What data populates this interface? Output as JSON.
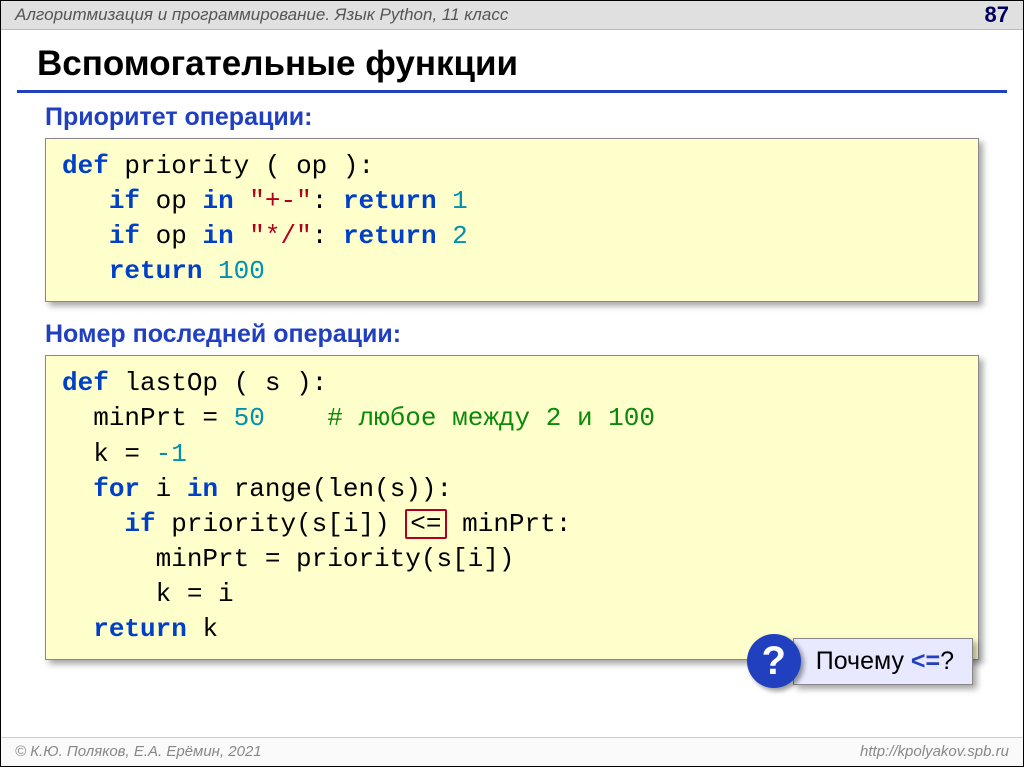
{
  "header": {
    "breadcrumb": "Алгоритмизация и программирование. Язык Python, 11 класс",
    "page": "87"
  },
  "title": "Вспомогательные функции",
  "sections": {
    "s1": {
      "heading": "Приоритет операции:",
      "code": {
        "l1a": "def",
        "l1b": "priority",
        "l1c": "( op ):",
        "l2a": "if",
        "l2b": "op",
        "l2c": "in",
        "l2d": "\"+-\"",
        "l2e": ": ",
        "l2f": "return",
        "l2g": "1",
        "l3a": "if",
        "l3b": "op",
        "l3c": "in",
        "l3d": "\"*/\"",
        "l3e": ": ",
        "l3f": "return",
        "l3g": "2",
        "l4a": "return",
        "l4b": "100"
      }
    },
    "s2": {
      "heading": "Номер последней операции:",
      "code": {
        "l1a": "def",
        "l1b": "lastOp",
        "l1c": "( s ):",
        "l2a": "minPrt =",
        "l2b": "50",
        "l2c": "# любое между 2 и 100",
        "l3a": "k =",
        "l3b": "-1",
        "l4a": "for",
        "l4b": "i",
        "l4c": "in",
        "l4d": "range(len(s)):",
        "l5a": "if",
        "l5b": "priority(s[i])",
        "l5op": "<=",
        "l5c": "minPrt:",
        "l6": "minPrt = priority(s[i])",
        "l7": "k = i",
        "l8a": "return",
        "l8b": "k"
      }
    }
  },
  "callout": {
    "mark": "?",
    "text_a": "Почему ",
    "op": "<=",
    "text_b": "?"
  },
  "footer": {
    "copyright": "© К.Ю. Поляков, Е.А. Ерёмин, 2021",
    "url": "http://kpolyakov.spb.ru"
  }
}
